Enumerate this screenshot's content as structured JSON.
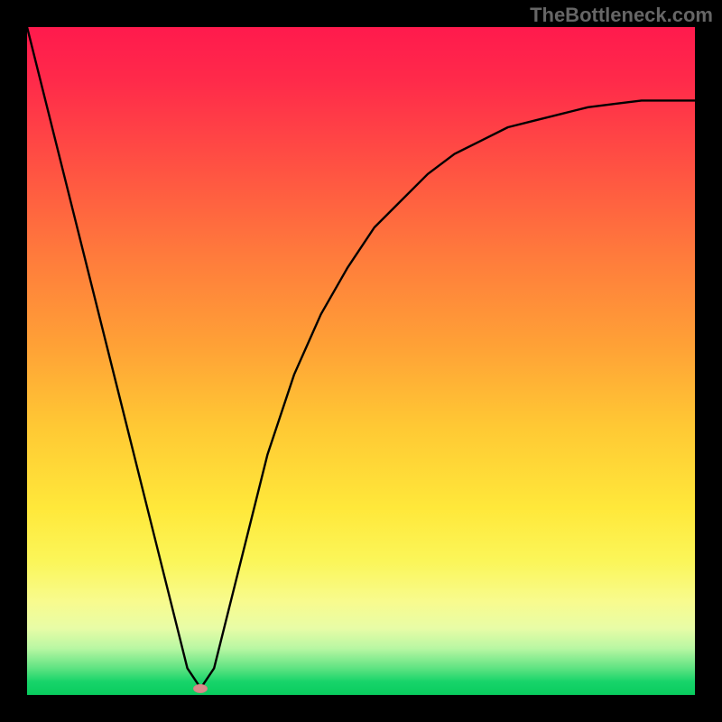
{
  "watermark": "TheBottleneck.com",
  "chart_data": {
    "type": "line",
    "title": "",
    "xlabel": "",
    "ylabel": "",
    "xlim": [
      0,
      100
    ],
    "ylim": [
      0,
      100
    ],
    "series": [
      {
        "name": "curve",
        "x": [
          0,
          4,
          8,
          12,
          16,
          20,
          22,
          24,
          26,
          28,
          30,
          33,
          36,
          40,
          44,
          48,
          52,
          56,
          60,
          64,
          68,
          72,
          76,
          80,
          84,
          88,
          92,
          96,
          100
        ],
        "y": [
          100,
          84,
          68,
          52,
          36,
          20,
          12,
          4,
          1,
          4,
          12,
          24,
          36,
          48,
          57,
          64,
          70,
          74,
          78,
          81,
          83,
          85,
          86,
          87,
          88,
          88.5,
          89,
          89,
          89
        ]
      }
    ],
    "marker": {
      "name": "min-dot",
      "x": 26,
      "y": 1
    },
    "gradient_stops": [
      {
        "pos": 0,
        "color": "#ff1a4d"
      },
      {
        "pos": 50,
        "color": "#ffb335"
      },
      {
        "pos": 80,
        "color": "#fbf659"
      },
      {
        "pos": 100,
        "color": "#08cc5e"
      }
    ]
  }
}
